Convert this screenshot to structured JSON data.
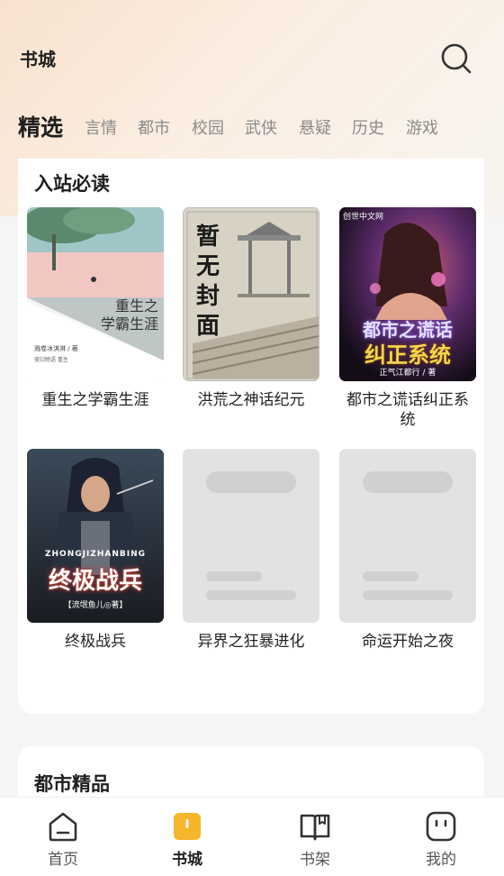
{
  "header": {
    "title": "书城",
    "search_icon": "search-icon"
  },
  "tabs": [
    {
      "label": "精选",
      "active": true
    },
    {
      "label": "言情",
      "active": false
    },
    {
      "label": "都市",
      "active": false
    },
    {
      "label": "校园",
      "active": false
    },
    {
      "label": "武侠",
      "active": false
    },
    {
      "label": "悬疑",
      "active": false
    },
    {
      "label": "历史",
      "active": false
    },
    {
      "label": "游戏",
      "active": false
    }
  ],
  "section1": {
    "title": "入站必读",
    "books": [
      {
        "title": "重生之学霸生涯",
        "cover_title": "重生之\n学霸生涯",
        "cover_author": "溅卷冰淇淋 / 著",
        "cover_note": "夜归物语 重生"
      },
      {
        "title": "洪荒之神话纪元",
        "cover_title": "暂无封面"
      },
      {
        "title": "都市之谎话纠正系统",
        "cover_title1": "都市之谎话",
        "cover_title2": "纠正系统",
        "cover_author": "正气江都行 / 著",
        "cover_publisher": "创世中文网"
      },
      {
        "title": "终极战兵",
        "cover_pinyin": "ZHONGJIZHANBING",
        "cover_title": "终极战兵",
        "cover_author": "【流氓鱼儿◎著】"
      },
      {
        "title": "异界之狂暴进化"
      },
      {
        "title": "命运开始之夜"
      }
    ]
  },
  "section2": {
    "title": "都市精品"
  },
  "bottom_nav": [
    {
      "label": "首页",
      "icon": "home-icon",
      "active": false
    },
    {
      "label": "书城",
      "icon": "bookstore-icon",
      "active": true
    },
    {
      "label": "书架",
      "icon": "bookshelf-icon",
      "active": false
    },
    {
      "label": "我的",
      "icon": "profile-icon",
      "active": false
    }
  ],
  "colors": {
    "accent": "#f7b52b",
    "background": "#f5f5f5"
  }
}
